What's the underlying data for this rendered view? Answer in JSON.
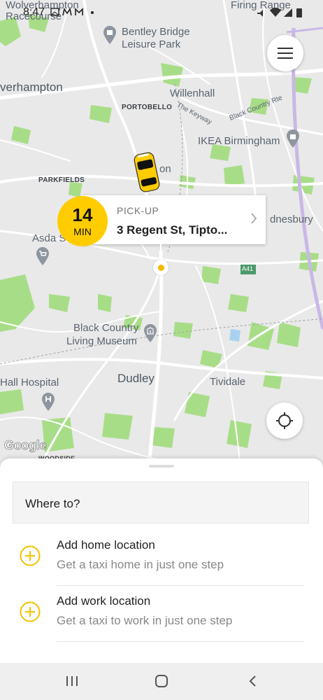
{
  "status": {
    "time": "8:47",
    "notification_icons": [
      "image-icon",
      "mail-icon",
      "mail-icon",
      "dot-icon"
    ],
    "right_icons": [
      "mute-icon",
      "wifi-icon",
      "signal-icon",
      "battery-icon"
    ]
  },
  "map": {
    "labels": [
      {
        "name": "place-wolverhampton-racecourse-1",
        "text": "Wolverhampton",
        "style": "normal"
      },
      {
        "name": "place-wolverhampton-racecourse-2",
        "text": "Racecourse",
        "style": "normal"
      },
      {
        "name": "place-firing-range",
        "text": "Firing Range",
        "style": "normal"
      },
      {
        "name": "place-bentley-bridge-1",
        "text": "Bentley Bridge",
        "style": "normal"
      },
      {
        "name": "place-bentley-bridge-2",
        "text": "Leisure Park",
        "style": "normal"
      },
      {
        "name": "place-wolverhampton",
        "text": "verhampton",
        "style": "big"
      },
      {
        "name": "place-willenhall",
        "text": "Willenhall",
        "style": "normal"
      },
      {
        "name": "place-portobello",
        "text": "PORTOBELLO",
        "style": "small"
      },
      {
        "name": "road-the-keyway",
        "text": "The Keyway",
        "style": "road"
      },
      {
        "name": "road-black-country-rte",
        "text": "Black Country Rte",
        "style": "road"
      },
      {
        "name": "place-ikea-birmingham",
        "text": "IKEA Birmingham",
        "style": "normal"
      },
      {
        "name": "place-parkfields",
        "text": "PARKFIELDS",
        "style": "small"
      },
      {
        "name": "place-bilston-fragment",
        "text": "on",
        "style": "normal"
      },
      {
        "name": "place-wednesbury-fragment",
        "text": "dnesbury",
        "style": "normal"
      },
      {
        "name": "place-asda",
        "text": "Asda S",
        "style": "normal"
      },
      {
        "name": "road-a41",
        "text": "A41",
        "style": "road"
      },
      {
        "name": "place-bcl-museum-1",
        "text": "Black Country",
        "style": "normal"
      },
      {
        "name": "place-bcl-museum-2",
        "text": "Living Museum",
        "style": "normal"
      },
      {
        "name": "place-hall-hospital",
        "text": "Hall Hospital",
        "style": "normal"
      },
      {
        "name": "place-dudley",
        "text": "Dudley",
        "style": "big"
      },
      {
        "name": "place-tividale",
        "text": "Tividale",
        "style": "normal"
      },
      {
        "name": "place-woodside",
        "text": "WOODSIDE",
        "style": "small"
      }
    ],
    "attribution": "Google"
  },
  "pickup": {
    "eta_value": "14",
    "eta_unit": "MIN",
    "caption": "PICK-UP",
    "address": "3 Regent St, Tipto..."
  },
  "sheet": {
    "search_label": "Where to?",
    "home_title": "Add home location",
    "home_subtitle": "Get a taxi home in just one step",
    "work_title": "Add work location",
    "work_subtitle": "Get a taxi to work in just one step"
  },
  "colors": {
    "accent": "#ffcc00",
    "plus_icon": "#f2c200",
    "map_bg": "#e9e9e9",
    "park": "#a8dd88"
  }
}
